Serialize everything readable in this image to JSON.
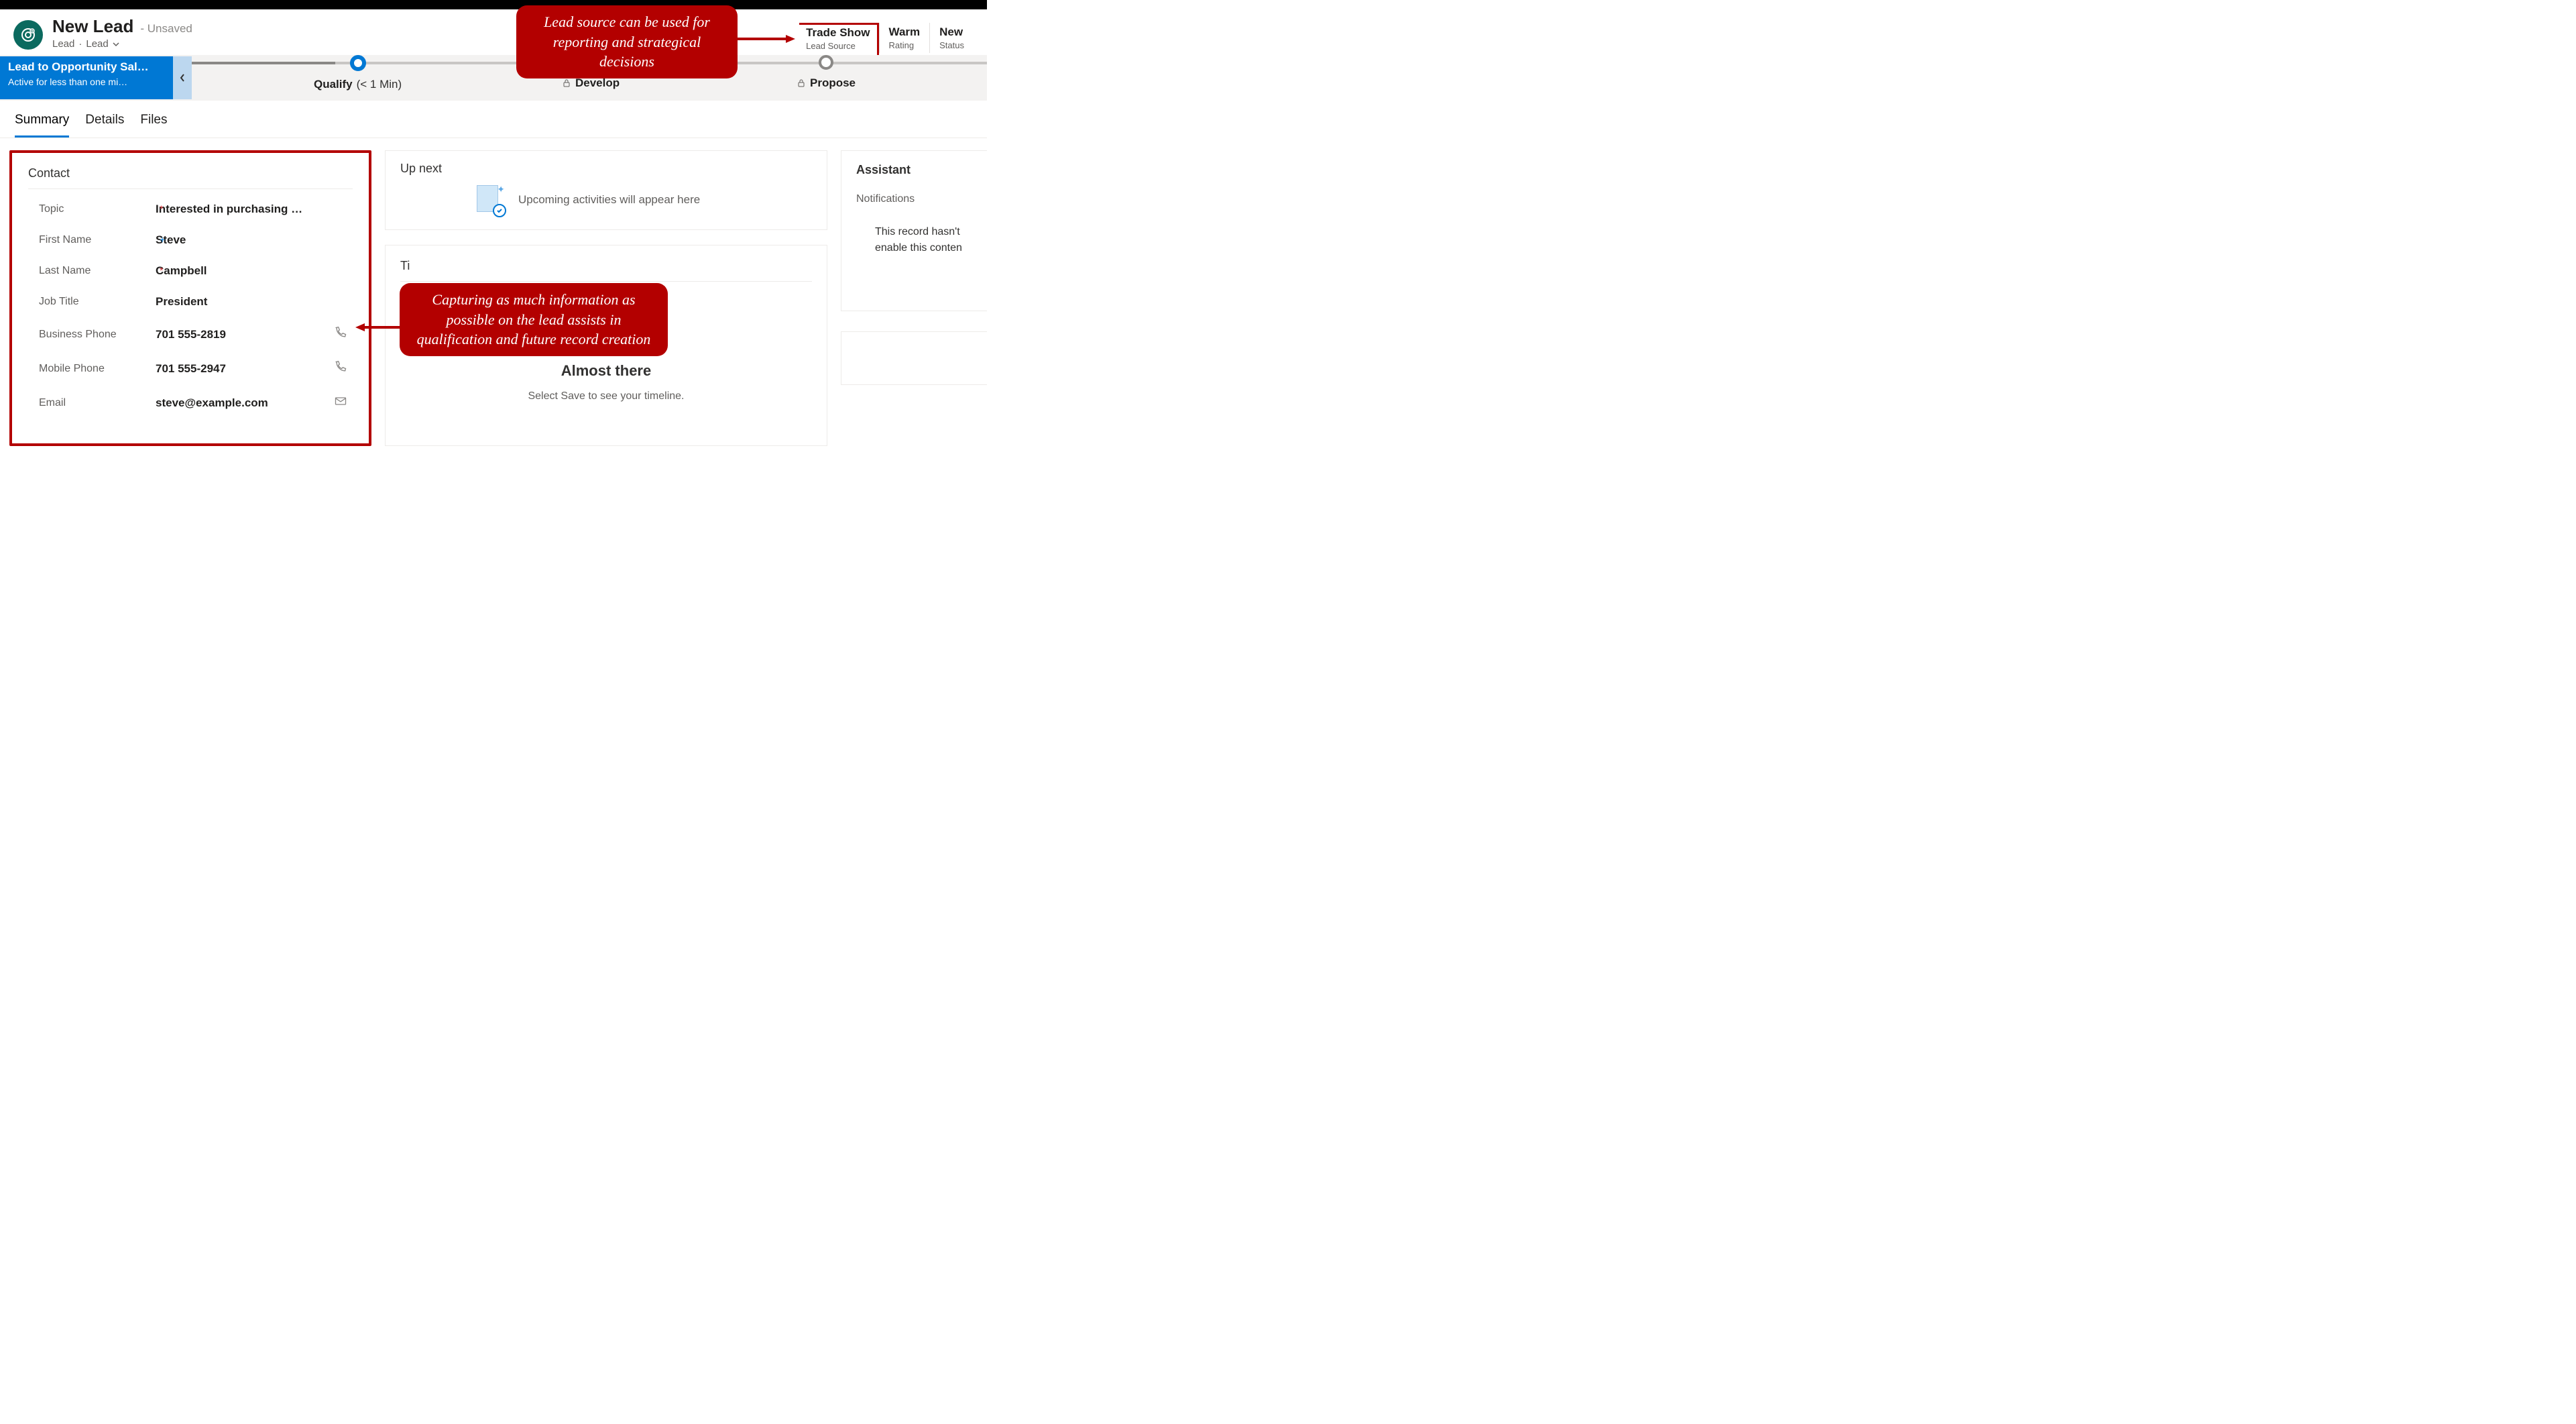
{
  "header": {
    "title": "New Lead",
    "state": "- Unsaved",
    "entity": "Lead",
    "form": "Lead"
  },
  "stats": {
    "leadSource": {
      "value": "Trade Show",
      "label": "Lead Source"
    },
    "rating": {
      "value": "Warm",
      "label": "Rating"
    },
    "status": {
      "value": "New",
      "label": "Status"
    }
  },
  "bpf": {
    "name": "Lead to Opportunity Sal…",
    "duration": "Active for less than one mi…",
    "stages": {
      "qualify": {
        "label": "Qualify",
        "duration": "(< 1 Min)"
      },
      "develop": {
        "label": "Develop"
      },
      "propose": {
        "label": "Propose"
      }
    }
  },
  "tabs": {
    "summary": "Summary",
    "details": "Details",
    "files": "Files"
  },
  "contact": {
    "title": "Contact",
    "fields": {
      "topic": {
        "label": "Topic",
        "value": "Interested in purchasing …"
      },
      "firstName": {
        "label": "First Name",
        "value": "Steve"
      },
      "lastName": {
        "label": "Last Name",
        "value": "Campbell"
      },
      "jobTitle": {
        "label": "Job Title",
        "value": "President"
      },
      "businessPhone": {
        "label": "Business Phone",
        "value": "701 555-2819"
      },
      "mobilePhone": {
        "label": "Mobile Phone",
        "value": "701 555-2947"
      },
      "email": {
        "label": "Email",
        "value": "steve@example.com"
      }
    }
  },
  "upnext": {
    "title": "Up next",
    "empty": "Upcoming activities will appear here"
  },
  "timeline": {
    "titlePrefix": "Ti",
    "almostTitle": "Almost there",
    "almostSub": "Select Save to see your timeline."
  },
  "assistant": {
    "title": "Assistant",
    "notificationsLabel": "Notifications",
    "body1": "This record hasn't",
    "body2": "enable this conten"
  },
  "annotations": {
    "callout1": "Lead source can be used for reporting and strategical decisions",
    "callout2": "Capturing as much information as possible on the lead assists in qualification and future record creation"
  }
}
